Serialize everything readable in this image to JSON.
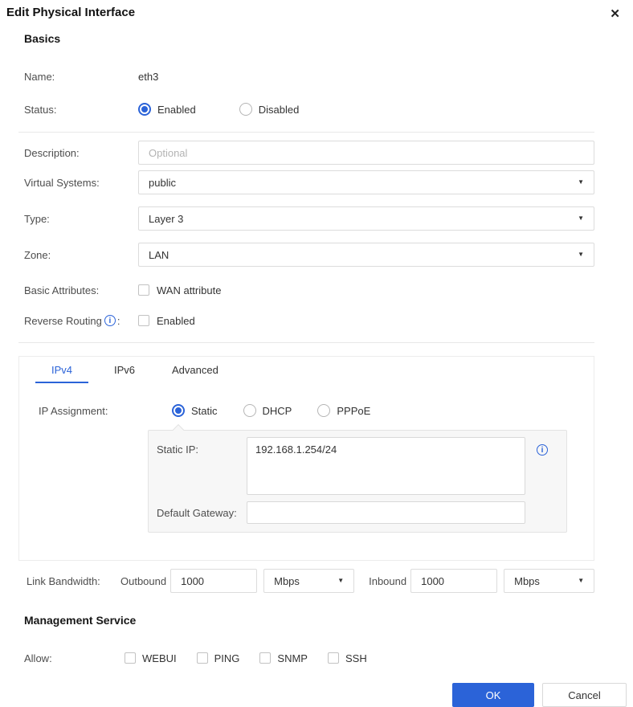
{
  "dialog": {
    "title": "Edit Physical Interface"
  },
  "icons": {
    "close": "✕",
    "caret": "▼",
    "info": "i"
  },
  "basics": {
    "heading": "Basics",
    "name_label": "Name:",
    "name_value": "eth3",
    "status_label": "Status:",
    "status_options": [
      {
        "label": "Enabled",
        "selected": true
      },
      {
        "label": "Disabled",
        "selected": false
      }
    ],
    "description_label": "Description:",
    "description_placeholder": "Optional",
    "virtual_systems_label": "Virtual Systems:",
    "virtual_systems_value": "public",
    "type_label": "Type:",
    "type_value": "Layer 3",
    "zone_label": "Zone:",
    "zone_value": "LAN",
    "basic_attributes_label": "Basic Attributes:",
    "wan_attribute_label": "WAN attribute",
    "wan_attribute_checked": false,
    "reverse_routing_label": "Reverse Routing",
    "reverse_routing_colon": ":",
    "reverse_routing_option_label": "Enabled",
    "reverse_routing_checked": false
  },
  "tabs": [
    {
      "label": "IPv4",
      "active": true
    },
    {
      "label": "IPv6",
      "active": false
    },
    {
      "label": "Advanced",
      "active": false
    }
  ],
  "ipv4_tab": {
    "ip_assignment_label": "IP Assignment:",
    "ip_assignment_options": [
      {
        "label": "Static",
        "selected": true
      },
      {
        "label": "DHCP",
        "selected": false
      },
      {
        "label": "PPPoE",
        "selected": false
      }
    ],
    "static_ip_label": "Static IP:",
    "static_ip_value": "192.168.1.254/24",
    "default_gateway_label": "Default Gateway:",
    "default_gateway_value": ""
  },
  "link_bandwidth": {
    "label": "Link Bandwidth:",
    "outbound_label": "Outbound",
    "outbound_value": "1000",
    "outbound_unit": "Mbps",
    "inbound_label": "Inbound",
    "inbound_value": "1000",
    "inbound_unit": "Mbps"
  },
  "management_service": {
    "heading": "Management Service",
    "allow_label": "Allow:",
    "options": [
      {
        "label": "WEBUI",
        "checked": false
      },
      {
        "label": "PING",
        "checked": false
      },
      {
        "label": "SNMP",
        "checked": false
      },
      {
        "label": "SSH",
        "checked": false
      }
    ]
  },
  "footer": {
    "ok_label": "OK",
    "cancel_label": "Cancel"
  },
  "colors": {
    "accent": "#2b63d8",
    "panel_bg": "#f7f7f7",
    "border": "#dcdcdc",
    "divider": "#e8e8e8"
  }
}
